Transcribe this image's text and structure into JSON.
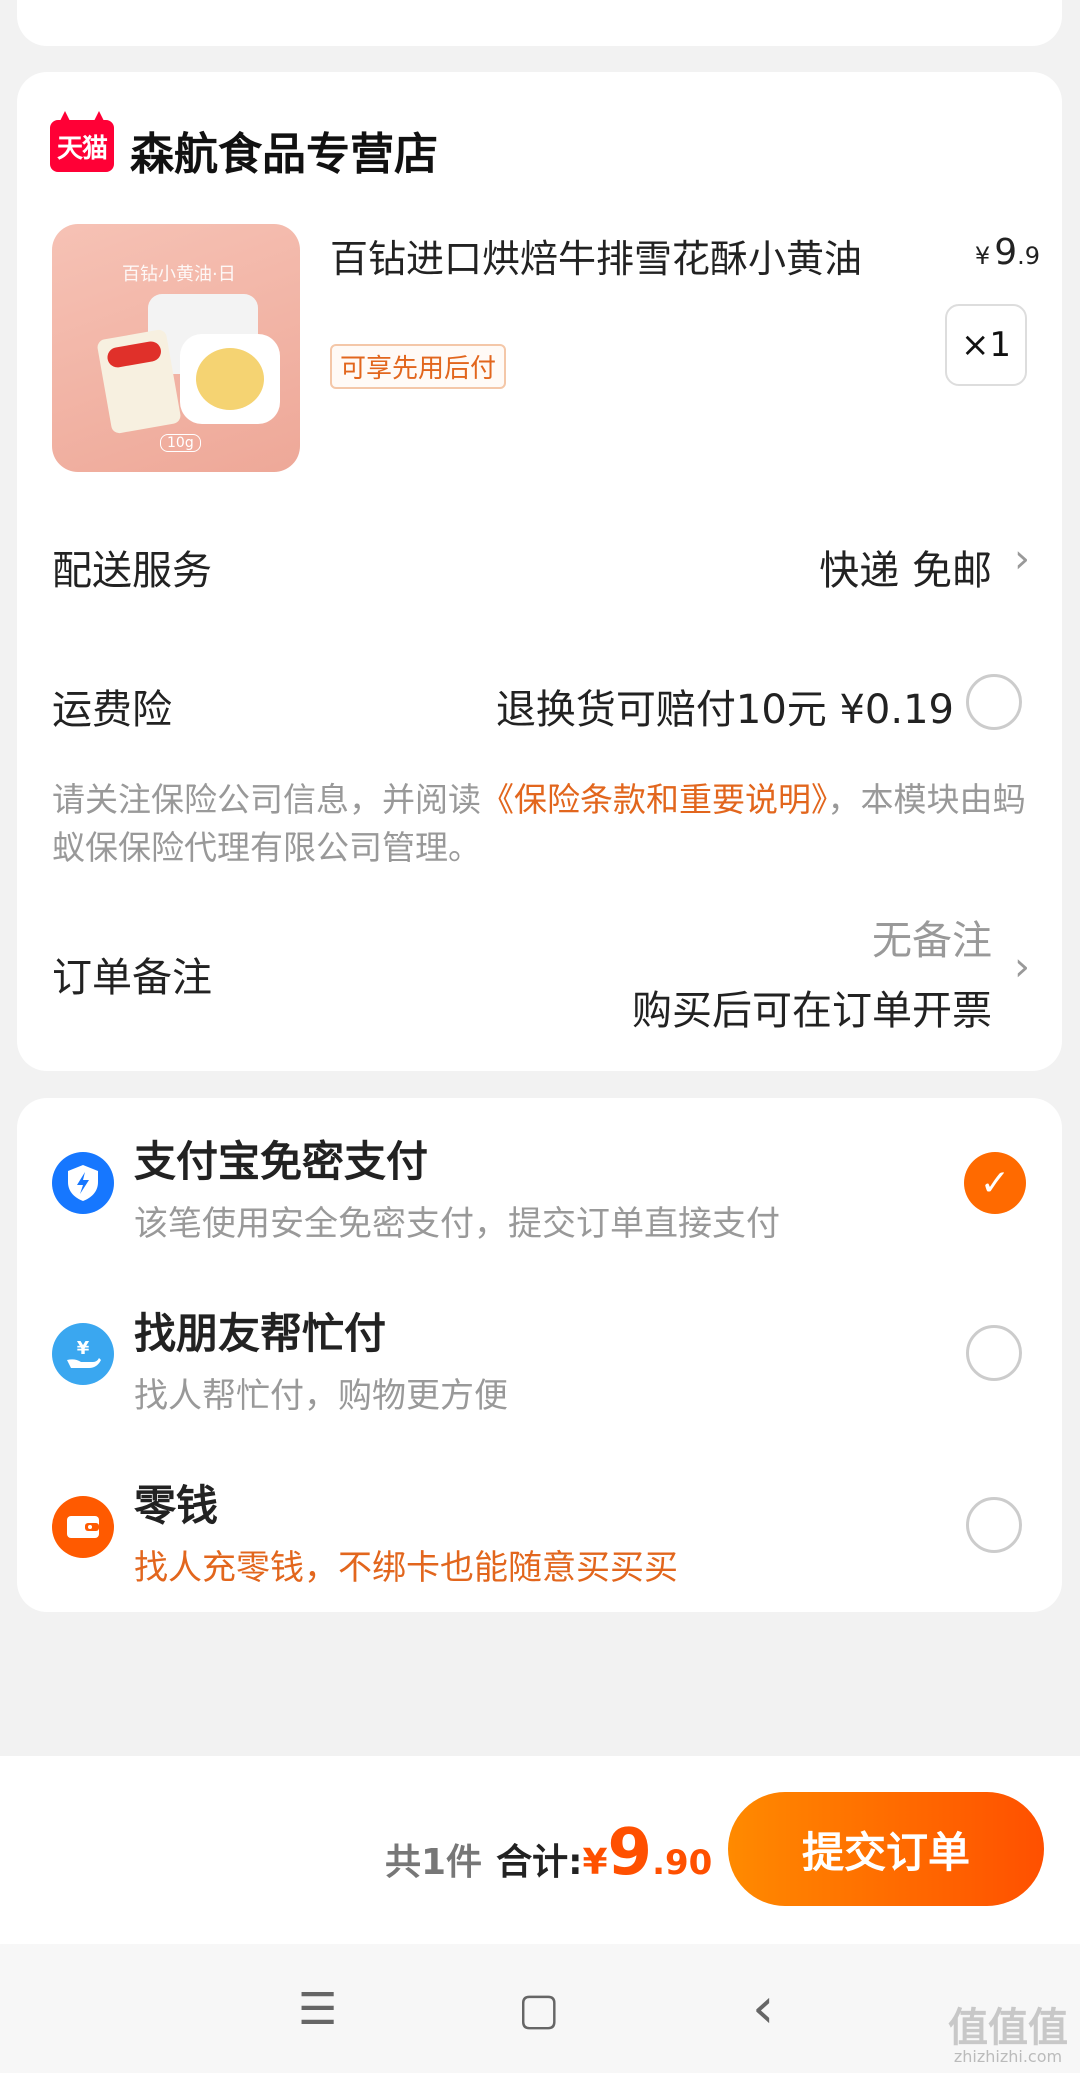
{
  "store": {
    "logo_text": "天猫",
    "name": "森航食品专营店"
  },
  "product": {
    "image_label": "百钻小黄油·日",
    "image_weight": "10g",
    "title": "百钻进口烘焙牛排雪花酥小黄油",
    "price_currency": "¥",
    "price_int": "9",
    "price_dec": ".9",
    "quantity": "×1",
    "badge": "可享先用后付"
  },
  "delivery": {
    "label": "配送服务",
    "value": "快递 免邮"
  },
  "freight_insurance": {
    "label": "运费险",
    "value": "退换货可赔付10元  ¥0.19"
  },
  "notice": {
    "before": "请关注保险公司信息，并阅读",
    "link": "《保险条款和重要说明》",
    "after": "，本模块由蚂蚁保保险代理有限公司管理。"
  },
  "order_note": {
    "label": "订单备注",
    "value_1": "无备注",
    "value_2": "购买后可在订单开票"
  },
  "payment_methods": [
    {
      "title": "支付宝免密支付",
      "subtitle": "该笔使用安全免密支付，提交订单直接支付",
      "selected": true,
      "icon": "alipay-shield-icon",
      "color": "#1677ff"
    },
    {
      "title": "找朋友帮忙付",
      "subtitle": "找人帮忙付，购物更方便",
      "selected": false,
      "icon": "friend-pay-icon",
      "color": "#3aa7f0"
    },
    {
      "title": "零钱",
      "subtitle": "找人充零钱，不绑卡也能随意买买买",
      "selected": false,
      "icon": "wallet-icon",
      "color": "#ff5a00"
    }
  ],
  "footer": {
    "count": "共1件",
    "total_label": "合计:",
    "total_currency": "¥",
    "total_int": "9",
    "total_dec": ".90",
    "submit": "提交订单"
  },
  "nav": {
    "menu_icon": "☰",
    "home_icon": "▢",
    "back_icon": "‹"
  },
  "watermark": {
    "text": "值值值",
    "url": "zhizhizhi.com"
  },
  "colors": {
    "accent": "#ff5000",
    "link": "#e2661d",
    "tmall": "#ff0036"
  }
}
